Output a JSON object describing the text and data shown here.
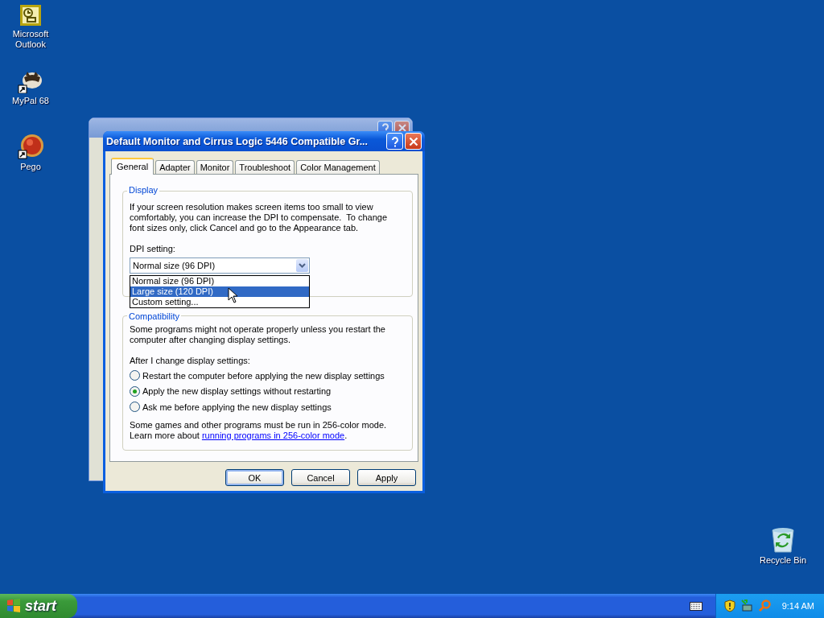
{
  "desktop_icons": [
    {
      "label": "Microsoft Outlook",
      "kind": "outlook"
    },
    {
      "label": "MyPal 68",
      "kind": "mypal"
    },
    {
      "label": "Pego",
      "kind": "pego"
    },
    {
      "label": "Recycle Bin",
      "kind": "recycle"
    }
  ],
  "dialog": {
    "title": "Default Monitor and Cirrus Logic 5446 Compatible Gr...",
    "tabs": [
      {
        "label": "General",
        "selected": true
      },
      {
        "label": "Adapter",
        "selected": false
      },
      {
        "label": "Monitor",
        "selected": false
      },
      {
        "label": "Troubleshoot",
        "selected": false
      },
      {
        "label": "Color Management",
        "selected": false
      }
    ],
    "display_group": {
      "legend": "Display",
      "description": "If your screen resolution makes screen items too small to view comfortably, you can increase the DPI to compensate.  To change font sizes only, click Cancel and go to the Appearance tab.",
      "dpi_label": "DPI setting:",
      "dpi_value": "Normal size (96 DPI)",
      "expanded": true,
      "options": [
        {
          "label": "Normal size (96 DPI)",
          "selected": false
        },
        {
          "label": "Large size (120 DPI)",
          "selected": true
        },
        {
          "label": "Custom setting...",
          "selected": false
        }
      ]
    },
    "compatibility_group": {
      "legend": "Compatibility",
      "description": "Some programs might not operate properly unless you restart the computer after changing display settings.",
      "prompt": "After I change display settings:",
      "options": [
        {
          "label": "Restart the computer before applying the new display settings",
          "selected": false
        },
        {
          "label": "Apply the new display settings without restarting",
          "selected": true
        },
        {
          "label": "Ask me before applying the new display settings",
          "selected": false
        }
      ],
      "note": "Some games and other programs must be run in 256-color mode.",
      "learn_more": "Learn more about",
      "link": "running programs in 256-color mode",
      "link_suffix": "."
    },
    "buttons": [
      {
        "label": "OK",
        "default": true
      },
      {
        "label": "Cancel",
        "default": false
      },
      {
        "label": "Apply",
        "default": false
      }
    ]
  },
  "taskbar": {
    "start_label": "start",
    "clock": "9:14 AM"
  }
}
